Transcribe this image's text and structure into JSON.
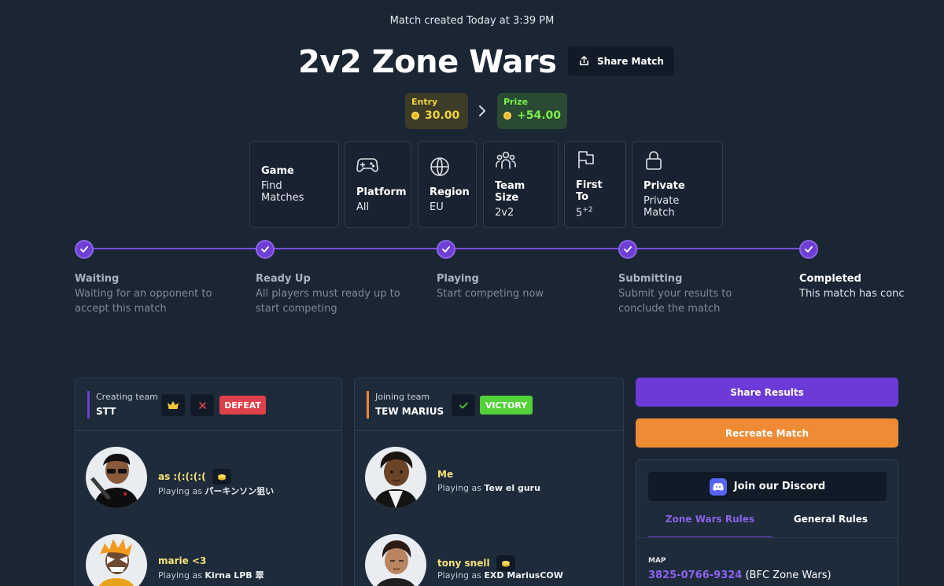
{
  "header": {
    "created": "Match created Today at 3:39 PM",
    "title": "2v2 Zone Wars",
    "share_label": "Share Match"
  },
  "stakes": {
    "entry_label": "Entry",
    "entry_value": "30.00",
    "prize_label": "Prize",
    "prize_value": "+54.00"
  },
  "info_cards": [
    {
      "key": "Game",
      "value": "Find Matches",
      "icon": "none"
    },
    {
      "key": "Platform",
      "value": "All",
      "icon": "gamepad-icon"
    },
    {
      "key": "Region",
      "value": "EU",
      "icon": "globe-icon"
    },
    {
      "key": "Team Size",
      "value": "2v2",
      "icon": "users-icon"
    },
    {
      "key": "First To",
      "value": "5",
      "value_sup": "+2",
      "icon": "flag-icon"
    },
    {
      "key": "Private",
      "value": "Private Match",
      "icon": "lock-icon"
    }
  ],
  "steps": [
    {
      "title": "Waiting",
      "desc": "Waiting for an opponent to accept this match"
    },
    {
      "title": "Ready Up",
      "desc": "All players must ready up to start competing"
    },
    {
      "title": "Playing",
      "desc": "Start competing now"
    },
    {
      "title": "Submitting",
      "desc": "Submit your results to conclude the match"
    },
    {
      "title": "Completed",
      "desc": "This match has conc"
    }
  ],
  "teams": {
    "creating": {
      "role": "Creating team",
      "name": "STT",
      "result": "DEFEAT",
      "players": [
        {
          "name": "as :(:(:(:(",
          "playing_as_prefix": "Playing as",
          "playing_as": "パーキンソン狙い"
        },
        {
          "name": "marie <3",
          "playing_as_prefix": "Playing as",
          "playing_as": "Kirna LPB 翠"
        }
      ]
    },
    "joining": {
      "role": "Joining team",
      "name": "TEW MARIUS",
      "result": "VICTORY",
      "players": [
        {
          "name": "Me",
          "playing_as_prefix": "Playing as",
          "playing_as": "Tew el guru"
        },
        {
          "name": "tony snell",
          "playing_as_prefix": "Playing as",
          "playing_as": "EXD MariusCOW"
        }
      ]
    }
  },
  "actions": {
    "share_results": "Share Results",
    "recreate": "Recreate Match"
  },
  "rules": {
    "discord_label": "Join our Discord",
    "tabs": [
      "Zone Wars Rules",
      "General Rules"
    ],
    "map_key": "MAP",
    "map_code": "3825-0766-9324",
    "map_name": "(BFC Zone Wars)"
  },
  "colors": {
    "accent": "#6c3ad6",
    "defeat": "#e0404a",
    "victory": "#52d138",
    "recreate": "#ee8b34"
  }
}
